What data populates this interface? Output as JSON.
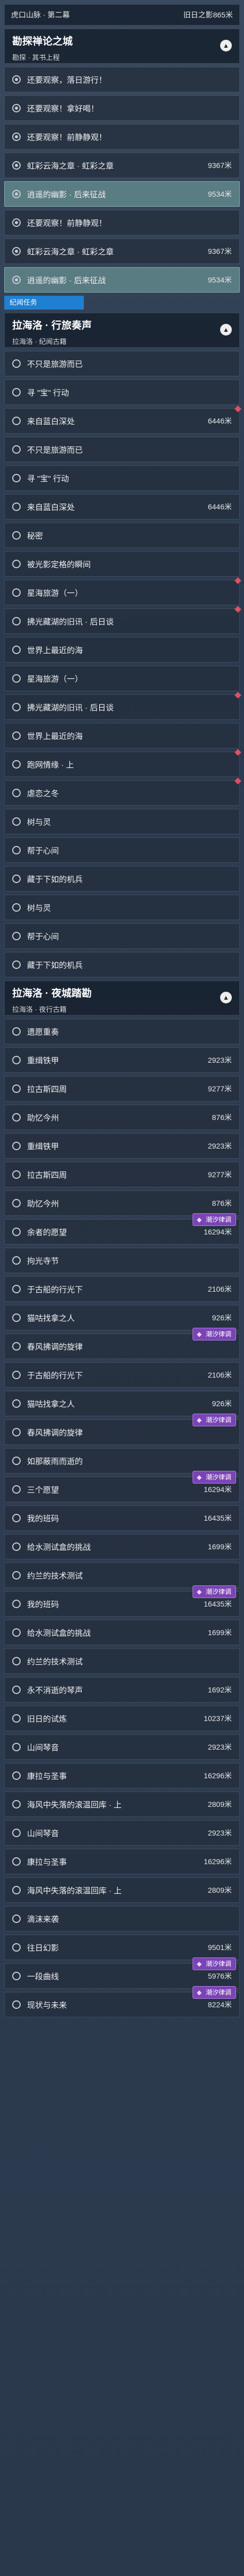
{
  "header": {
    "subtitle": "虎口山脉 · 第二幕"
  },
  "section_tag": "纪闻任务",
  "groups": [
    {
      "key": "g1",
      "title": "勘探禅论之城",
      "sub": "勘探 · 其书上程",
      "toggle": "▲"
    },
    {
      "key": "g2",
      "title": "拉海洛 · 行旅奏声",
      "sub": "拉海洛 · 纪闻古籍",
      "toggle": "▲"
    },
    {
      "key": "g3",
      "title": "拉海洛 · 夜城踏勘",
      "sub": "拉海洛 · 夜行古籍",
      "toggle": "▲"
    }
  ],
  "items": [
    {
      "kind": "top",
      "name": "旧日之影",
      "dist": "865米"
    },
    {
      "kind": "group",
      "g": 0
    },
    {
      "kind": "row",
      "name": "还要观察，落日游行！",
      "dist": "",
      "state": "done"
    },
    {
      "kind": "row",
      "name": "还要观察！拿好喝！",
      "dist": "",
      "state": "done"
    },
    {
      "kind": "row",
      "name": "还要观察！前静静观！",
      "dist": "",
      "state": "done"
    },
    {
      "kind": "row",
      "name": "虹彩云海之章 · 虹彩之章",
      "dist": "9367米",
      "state": "done"
    },
    {
      "kind": "row",
      "name": "逍遥的幽影 · 后来征战",
      "dist": "9534米",
      "state": "hl"
    },
    {
      "kind": "row",
      "name": "还要观察！前静静观！",
      "dist": "",
      "state": "done"
    },
    {
      "kind": "row",
      "name": "虹彩云海之章 · 虹彩之章",
      "dist": "9367米",
      "state": "done"
    },
    {
      "kind": "row",
      "name": "逍遥的幽影 · 后来征战",
      "dist": "9534米",
      "state": "hl"
    },
    {
      "kind": "tag"
    },
    {
      "kind": "group",
      "g": 1
    },
    {
      "kind": "row",
      "name": "不只是旅游而已",
      "dist": "",
      "state": "open"
    },
    {
      "kind": "row",
      "name": "寻 \"宝\" 行动",
      "dist": "",
      "state": "open"
    },
    {
      "kind": "row",
      "name": "来自蓝白深处",
      "dist": "6446米",
      "state": "open",
      "red": true
    },
    {
      "kind": "row",
      "name": "不只是旅游而已",
      "dist": "",
      "state": "open"
    },
    {
      "kind": "row",
      "name": "寻 \"宝\" 行动",
      "dist": "",
      "state": "open"
    },
    {
      "kind": "row",
      "name": "来自蓝白深处",
      "dist": "6446米",
      "state": "open"
    },
    {
      "kind": "row",
      "name": "秘密",
      "dist": "",
      "state": "open"
    },
    {
      "kind": "row",
      "name": "被光影定格的瞬间",
      "dist": "",
      "state": "open"
    },
    {
      "kind": "row",
      "name": "星海旅游（一）",
      "dist": "",
      "state": "open",
      "red": true
    },
    {
      "kind": "row",
      "name": "拂光藏湖的旧讯 · 后日谈",
      "dist": "",
      "state": "open",
      "red": true
    },
    {
      "kind": "row",
      "name": "世界上最近的海",
      "dist": "",
      "state": "open"
    },
    {
      "kind": "row",
      "name": "星海旅游（一）",
      "dist": "",
      "state": "open"
    },
    {
      "kind": "row",
      "name": "拂光藏湖的旧讯 · 后日谈",
      "dist": "",
      "state": "open",
      "red": true
    },
    {
      "kind": "row",
      "name": "世界上最近的海",
      "dist": "",
      "state": "open"
    },
    {
      "kind": "row",
      "name": "跑网情缘 · 上",
      "dist": "",
      "state": "open",
      "red": true
    },
    {
      "kind": "row",
      "name": "虐恋之冬",
      "dist": "",
      "state": "open",
      "red": true
    },
    {
      "kind": "row",
      "name": "树与灵",
      "dist": "",
      "state": "open"
    },
    {
      "kind": "row",
      "name": "帮于心间",
      "dist": "",
      "state": "open"
    },
    {
      "kind": "row",
      "name": "藏于下如的机兵",
      "dist": "",
      "state": "open"
    },
    {
      "kind": "row",
      "name": "树与灵",
      "dist": "",
      "state": "open"
    },
    {
      "kind": "row",
      "name": "帮于心间",
      "dist": "",
      "state": "open"
    },
    {
      "kind": "row",
      "name": "藏于下如的机兵",
      "dist": "",
      "state": "open"
    },
    {
      "kind": "group",
      "g": 2
    },
    {
      "kind": "row",
      "name": "遗愿重奏",
      "dist": "",
      "state": "open"
    },
    {
      "kind": "row",
      "name": "重缉铁甲",
      "dist": "2923米",
      "state": "open"
    },
    {
      "kind": "row",
      "name": "拉古斯四周",
      "dist": "9277米",
      "state": "open"
    },
    {
      "kind": "row",
      "name": "助忆今州",
      "dist": "876米",
      "state": "open"
    },
    {
      "kind": "row",
      "name": "重缉铁甲",
      "dist": "2923米",
      "state": "open"
    },
    {
      "kind": "row",
      "name": "拉古斯四周",
      "dist": "9277米",
      "state": "open"
    },
    {
      "kind": "row",
      "name": "助忆今州",
      "dist": "876米",
      "state": "open"
    },
    {
      "kind": "row",
      "name": "余者的愿望",
      "dist": "16294米",
      "state": "open",
      "badge": "潮汐律调"
    },
    {
      "kind": "row",
      "name": "拘光寺节",
      "dist": "",
      "state": "open"
    },
    {
      "kind": "row",
      "name": "于古船的行光下",
      "dist": "2106米",
      "state": "open"
    },
    {
      "kind": "row",
      "name": "猫咕找拿之人",
      "dist": "926米",
      "state": "open"
    },
    {
      "kind": "row",
      "name": "春风拂调的旋律",
      "dist": "",
      "state": "open",
      "badge": "潮汐律调"
    },
    {
      "kind": "row",
      "name": "于古船的行光下",
      "dist": "2106米",
      "state": "open"
    },
    {
      "kind": "row",
      "name": "猫咕找拿之人",
      "dist": "926米",
      "state": "open"
    },
    {
      "kind": "row",
      "name": "春风拂调的旋律",
      "dist": "",
      "state": "open",
      "badge": "潮汐律调"
    },
    {
      "kind": "row",
      "name": "如那蔽雨而逝的",
      "dist": "",
      "state": "open"
    },
    {
      "kind": "row",
      "name": "三个愿望",
      "dist": "16294米",
      "state": "open",
      "badge": "潮汐律调"
    },
    {
      "kind": "row",
      "name": "我的班码",
      "dist": "16435米",
      "state": "open"
    },
    {
      "kind": "row",
      "name": "给水测试盒的挑战",
      "dist": "1699米",
      "state": "open"
    },
    {
      "kind": "row",
      "name": "约兰的技术测试",
      "dist": "",
      "state": "open"
    },
    {
      "kind": "row",
      "name": "我的班码",
      "dist": "16435米",
      "state": "open",
      "badge": "潮汐律调"
    },
    {
      "kind": "row",
      "name": "给水测试盒的挑战",
      "dist": "1699米",
      "state": "open"
    },
    {
      "kind": "row",
      "name": "约兰的技术测试",
      "dist": "",
      "state": "open"
    },
    {
      "kind": "row",
      "name": "永不消逝的琴声",
      "dist": "1692米",
      "state": "open"
    },
    {
      "kind": "row",
      "name": "旧日的试炼",
      "dist": "10237米",
      "state": "open"
    },
    {
      "kind": "row",
      "name": "山间琴音",
      "dist": "2923米",
      "state": "open"
    },
    {
      "kind": "row",
      "name": "康拉与圣事",
      "dist": "16296米",
      "state": "open"
    },
    {
      "kind": "row",
      "name": "海风中失落的滚温回库 · 上",
      "dist": "2809米",
      "state": "open"
    },
    {
      "kind": "row",
      "name": "山间琴音",
      "dist": "2923米",
      "state": "open"
    },
    {
      "kind": "row",
      "name": "康拉与圣事",
      "dist": "16296米",
      "state": "open"
    },
    {
      "kind": "row",
      "name": "海风中失落的滚温回库 · 上",
      "dist": "2809米",
      "state": "open"
    },
    {
      "kind": "row",
      "name": "滴沫来袭",
      "dist": "",
      "state": "open"
    },
    {
      "kind": "row",
      "name": "往日幻影",
      "dist": "9501米",
      "state": "open"
    },
    {
      "kind": "row",
      "name": "一段曲线",
      "dist": "5976米",
      "state": "open",
      "badge": "潮汐律调"
    },
    {
      "kind": "row",
      "name": "现状与未来",
      "dist": "8224米",
      "state": "open",
      "badge": "潮汐律调"
    }
  ]
}
